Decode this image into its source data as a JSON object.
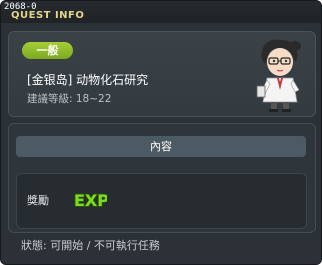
{
  "window": {
    "quest_id": "2068-0",
    "title": "QUEST INFO"
  },
  "quest": {
    "category_badge": "一般",
    "name": "[金银岛] 动物化石研究",
    "recommended_level": "建議等級: 18~22"
  },
  "content": {
    "header": "內容",
    "reward_label": "獎勵",
    "reward_icon": "exp-icon",
    "reward_icon_text": "EXP"
  },
  "status": "狀態: 可開始 / 不可執行任務",
  "colors": {
    "badge_green": "#8fbc2a",
    "title_gold": "#e2d58a",
    "exp_green": "#7cdc1e",
    "panel_bg": "#2b3136"
  }
}
